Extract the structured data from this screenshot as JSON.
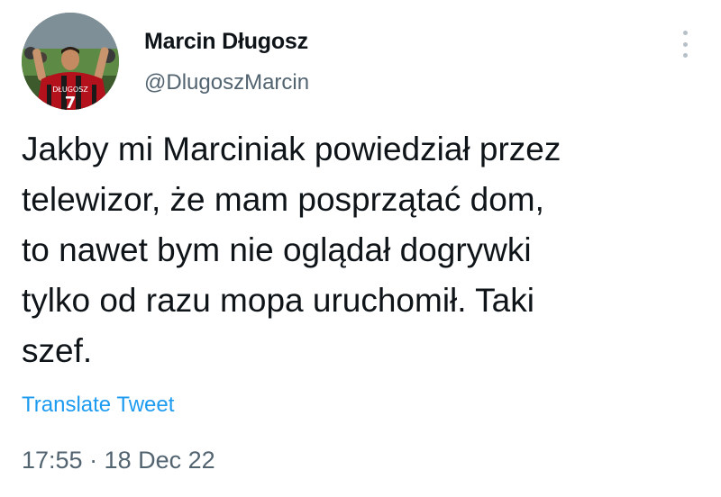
{
  "author": {
    "display_name": "Marcin Długosz",
    "handle": "@DlugoszMarcin"
  },
  "avatar": {
    "jersey_text": "DŁUGOSZ",
    "jersey_number": "7"
  },
  "tweet": {
    "text_lines": [
      "Jakby mi Marciniak powiedział przez",
      "telewizor, że mam posprzątać dom,",
      "to nawet bym nie oglądał dogrywki",
      "tylko od razu mopa uruchomił. Taki",
      "szef."
    ],
    "translate_label": "Translate Tweet",
    "timestamp": "17:55 · 18 Dec 22"
  },
  "icons": {
    "more": "more-options-icon"
  },
  "colors": {
    "text": "#0f1419",
    "secondary": "#536471",
    "link": "#1d9bf0"
  }
}
